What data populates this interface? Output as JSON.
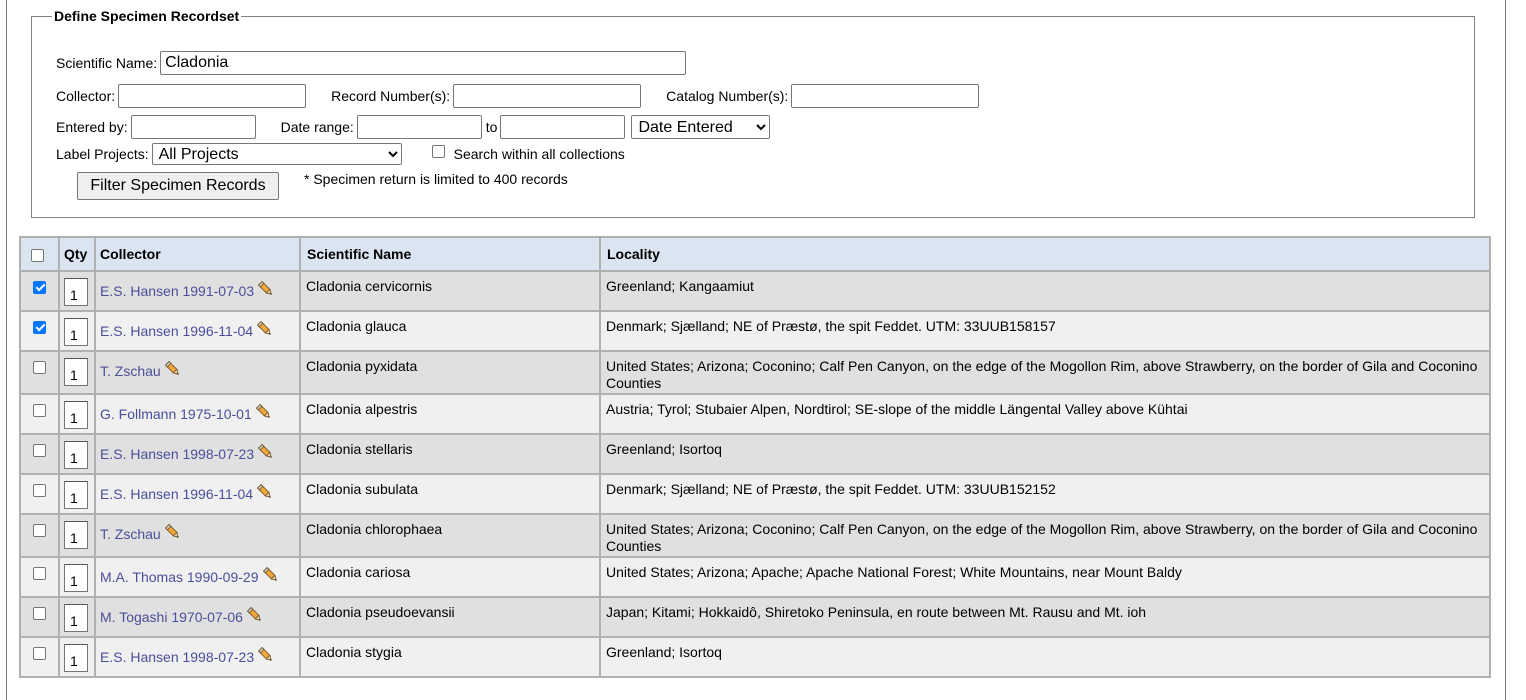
{
  "form": {
    "legend": "Define Specimen Recordset",
    "sciname_label": "Scientific Name:",
    "sciname_value": "Cladonia",
    "collector_label": "Collector:",
    "collector_value": "",
    "recordnum_label": "Record Number(s):",
    "recordnum_value": "",
    "catalognum_label": "Catalog Number(s):",
    "catalognum_value": "",
    "enteredby_label": "Entered by:",
    "enteredby_value": "",
    "daterange_label": "Date range:",
    "date_from": "",
    "to_label": "to",
    "date_to": "",
    "date_type": "Date Entered",
    "labelprojects_label": "Label Projects:",
    "labelprojects_value": "All Projects",
    "search_all_label": "Search within all collections",
    "search_all_checked": false,
    "filter_button": "Filter Specimen Records",
    "limit_note": "* Specimen return is limited to 400 records"
  },
  "table": {
    "headers": [
      "Qty",
      "Collector",
      "Scientific Name",
      "Locality"
    ],
    "rows": [
      {
        "checked": true,
        "qty": "1",
        "collector": "E.S. Hansen 1991-07-03",
        "sciname": "Cladonia cervicornis",
        "locality": "Greenland; Kangaamiut"
      },
      {
        "checked": true,
        "qty": "1",
        "collector": "E.S. Hansen 1996-11-04",
        "sciname": "Cladonia glauca",
        "locality": "Denmark; Sjælland; NE of Præstø, the spit Feddet. UTM: 33UUB158157"
      },
      {
        "checked": false,
        "qty": "1",
        "collector": "T. Zschau",
        "sciname": "Cladonia pyxidata",
        "locality": "United States; Arizona; Coconino; Calf Pen Canyon, on the edge of the Mogollon Rim, above Strawberry, on the border of Gila and Coconino Counties"
      },
      {
        "checked": false,
        "qty": "1",
        "collector": "G. Follmann 1975-10-01",
        "sciname": "Cladonia alpestris",
        "locality": "Austria; Tyrol; Stubaier Alpen, Nordtirol; SE-slope of the middle Längental Valley above Kühtai"
      },
      {
        "checked": false,
        "qty": "1",
        "collector": "E.S. Hansen 1998-07-23",
        "sciname": "Cladonia stellaris",
        "locality": "Greenland; Isortoq"
      },
      {
        "checked": false,
        "qty": "1",
        "collector": "E.S. Hansen 1996-11-04",
        "sciname": "Cladonia subulata",
        "locality": "Denmark; Sjælland; NE of Præstø, the spit Feddet. UTM: 33UUB152152"
      },
      {
        "checked": false,
        "qty": "1",
        "collector": "T. Zschau",
        "sciname": "Cladonia chlorophaea",
        "locality": "United States; Arizona; Coconino; Calf Pen Canyon, on the edge of the Mogollon Rim, above Strawberry, on the border of Gila and Coconino Counties"
      },
      {
        "checked": false,
        "qty": "1",
        "collector": "M.A. Thomas 1990-09-29",
        "sciname": "Cladonia cariosa",
        "locality": "United States; Arizona; Apache; Apache National Forest; White Mountains, near Mount Baldy"
      },
      {
        "checked": false,
        "qty": "1",
        "collector": "M. Togashi 1970-07-06",
        "sciname": "Cladonia pseudoevansii",
        "locality": "Japan; Kitami; Hokkaidô, Shiretoko Peninsula, en route between Mt. Rausu and Mt. ioh"
      },
      {
        "checked": false,
        "qty": "1",
        "collector": "E.S. Hansen 1998-07-23",
        "sciname": "Cladonia stygia",
        "locality": "Greenland; Isortoq"
      }
    ]
  }
}
